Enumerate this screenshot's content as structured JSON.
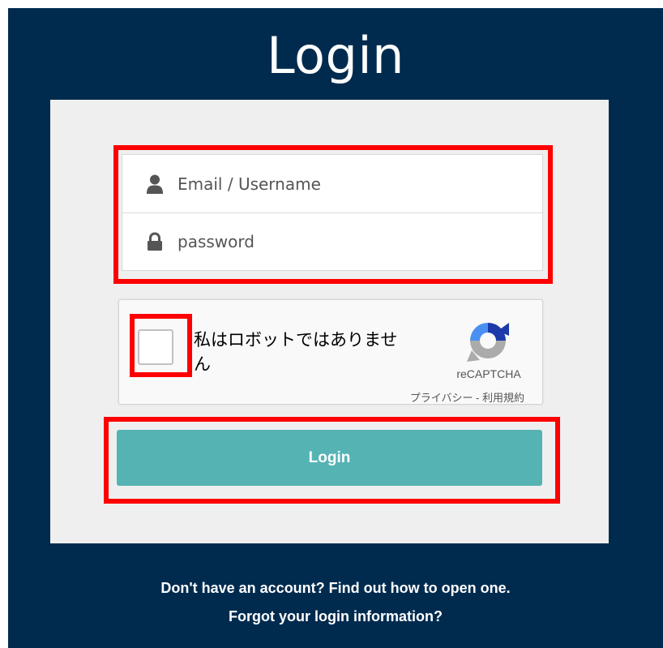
{
  "header": {
    "title": "Login"
  },
  "form": {
    "email_placeholder": "Email / Username",
    "password_placeholder": "password",
    "login_label": "Login"
  },
  "captcha": {
    "label": "私はロボットではありません",
    "brand": "reCAPTCHA",
    "terms": "プライバシー - 利用規約",
    "logo_icon": "recaptcha-logo-icon"
  },
  "footer": {
    "signup_link": "Don't have an account? Find out how to open one.",
    "forgot_link": "Forgot your login information?"
  },
  "icons": {
    "email": "user-icon",
    "password": "lock-icon"
  },
  "colors": {
    "background": "#002b4f",
    "panel": "#efefef",
    "button": "#55b3b4",
    "highlight": "#ff0000"
  }
}
